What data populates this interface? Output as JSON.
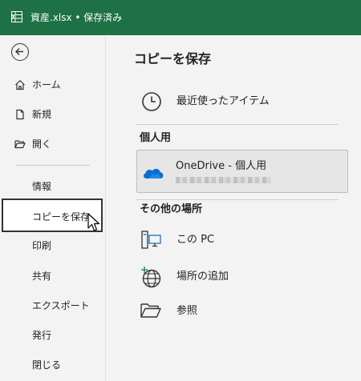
{
  "titlebar": {
    "title": "資産.xlsx • 保存済み"
  },
  "sidebar": {
    "items": [
      {
        "label": "ホーム"
      },
      {
        "label": "新規"
      },
      {
        "label": "開く"
      },
      {
        "label": "情報"
      },
      {
        "label": "コピーを保存"
      },
      {
        "label": "印刷"
      },
      {
        "label": "共有"
      },
      {
        "label": "エクスポート"
      },
      {
        "label": "発行"
      },
      {
        "label": "閉じる"
      }
    ]
  },
  "main": {
    "title": "コピーを保存",
    "recent_label": "最近使ったアイテム",
    "personal_header": "個人用",
    "onedrive_label": "OneDrive - 個人用",
    "other_header": "その他の場所",
    "places": [
      {
        "label": "この PC"
      },
      {
        "label": "場所の追加"
      },
      {
        "label": "参照"
      }
    ]
  },
  "colors": {
    "titlebar": "#1e7145",
    "onedrive": "#0a6ed1"
  },
  "icons": [
    "excel-icon",
    "back-arrow-icon",
    "home-icon",
    "new-file-icon",
    "open-folder-icon",
    "clock-icon",
    "onedrive-cloud-icon",
    "this-pc-icon",
    "add-place-globe-icon",
    "browse-folder-icon",
    "mouse-cursor-icon"
  ]
}
